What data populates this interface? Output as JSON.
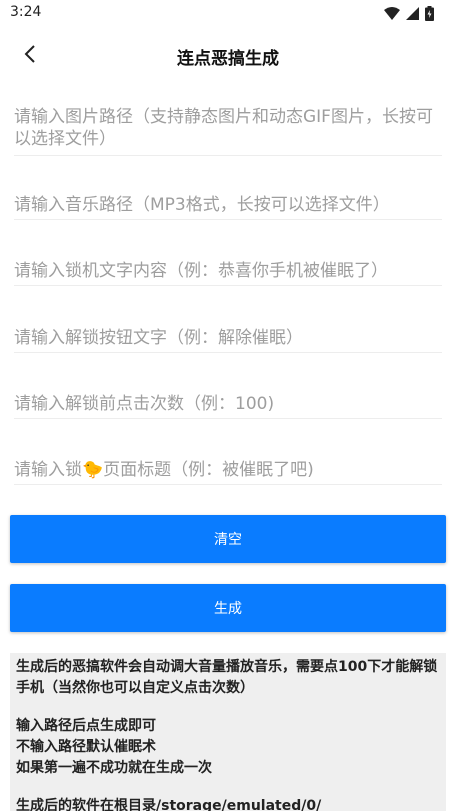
{
  "status_bar": {
    "time": "3:24",
    "icons": [
      "wifi-icon",
      "signal-icon",
      "battery-icon"
    ]
  },
  "app_bar": {
    "title": "连点恶搞生成",
    "back_icon": "arrow-back-icon"
  },
  "form": {
    "image_path_placeholder": "请输入图片路径（支持静态图片和动态GIF图片，长按可以选择文件）",
    "music_path_placeholder": "请输入音乐路径（MP3格式，长按可以选择文件）",
    "lock_text_placeholder": "请输入锁机文字内容（例：恭喜你手机被催眠了）",
    "unlock_button_text_placeholder": "请输入解锁按钮文字（例：解除催眠）",
    "click_count_placeholder": "请输入解锁前点击次数（例：100)",
    "page_title_placeholder": "请输入锁🐤页面标题（例：被催眠了吧)"
  },
  "buttons": {
    "clear_label": "清空",
    "generate_label": "生成"
  },
  "info": {
    "para1": "生成后的恶搞软件会自动调大音量播放音乐，需要点100下才能解锁手机（当然你也可以自定义点击次数）",
    "line2": "输入路径后点生成即可",
    "line3": "不输入路径默认催眠术",
    "line4": "如果第一遍不成功就在生成一次",
    "line5": "生成后的软件在根目录/storage/emulated/0/"
  },
  "colors": {
    "accent": "#0a7cff",
    "info_bg": "#efefef"
  }
}
